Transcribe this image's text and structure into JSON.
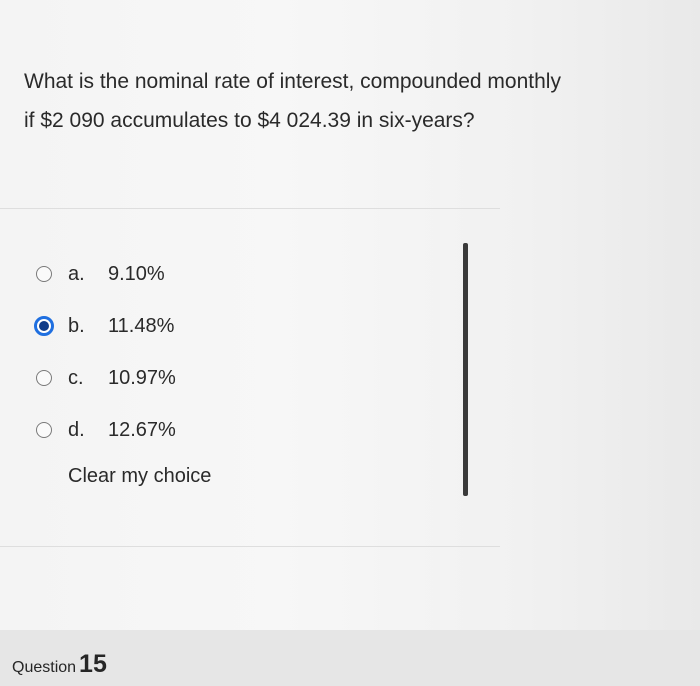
{
  "question": {
    "line1": "What is the nominal rate of interest, compounded monthly",
    "line2": "if $2 090 accumulates to $4 024.39 in six-years?"
  },
  "options": [
    {
      "letter": "a.",
      "value": "9.10%",
      "selected": false
    },
    {
      "letter": "b.",
      "value": "11.48%",
      "selected": true
    },
    {
      "letter": "c.",
      "value": "10.97%",
      "selected": false
    },
    {
      "letter": "d.",
      "value": "12.67%",
      "selected": false
    }
  ],
  "clear_choice_label": "Clear my choice",
  "footer": {
    "question_label": "Question",
    "question_number": "15"
  },
  "colors": {
    "radio_selected": "#1f6fe0",
    "radio_selected_dot": "#0f3c8a",
    "background": "#f4f4f4"
  }
}
